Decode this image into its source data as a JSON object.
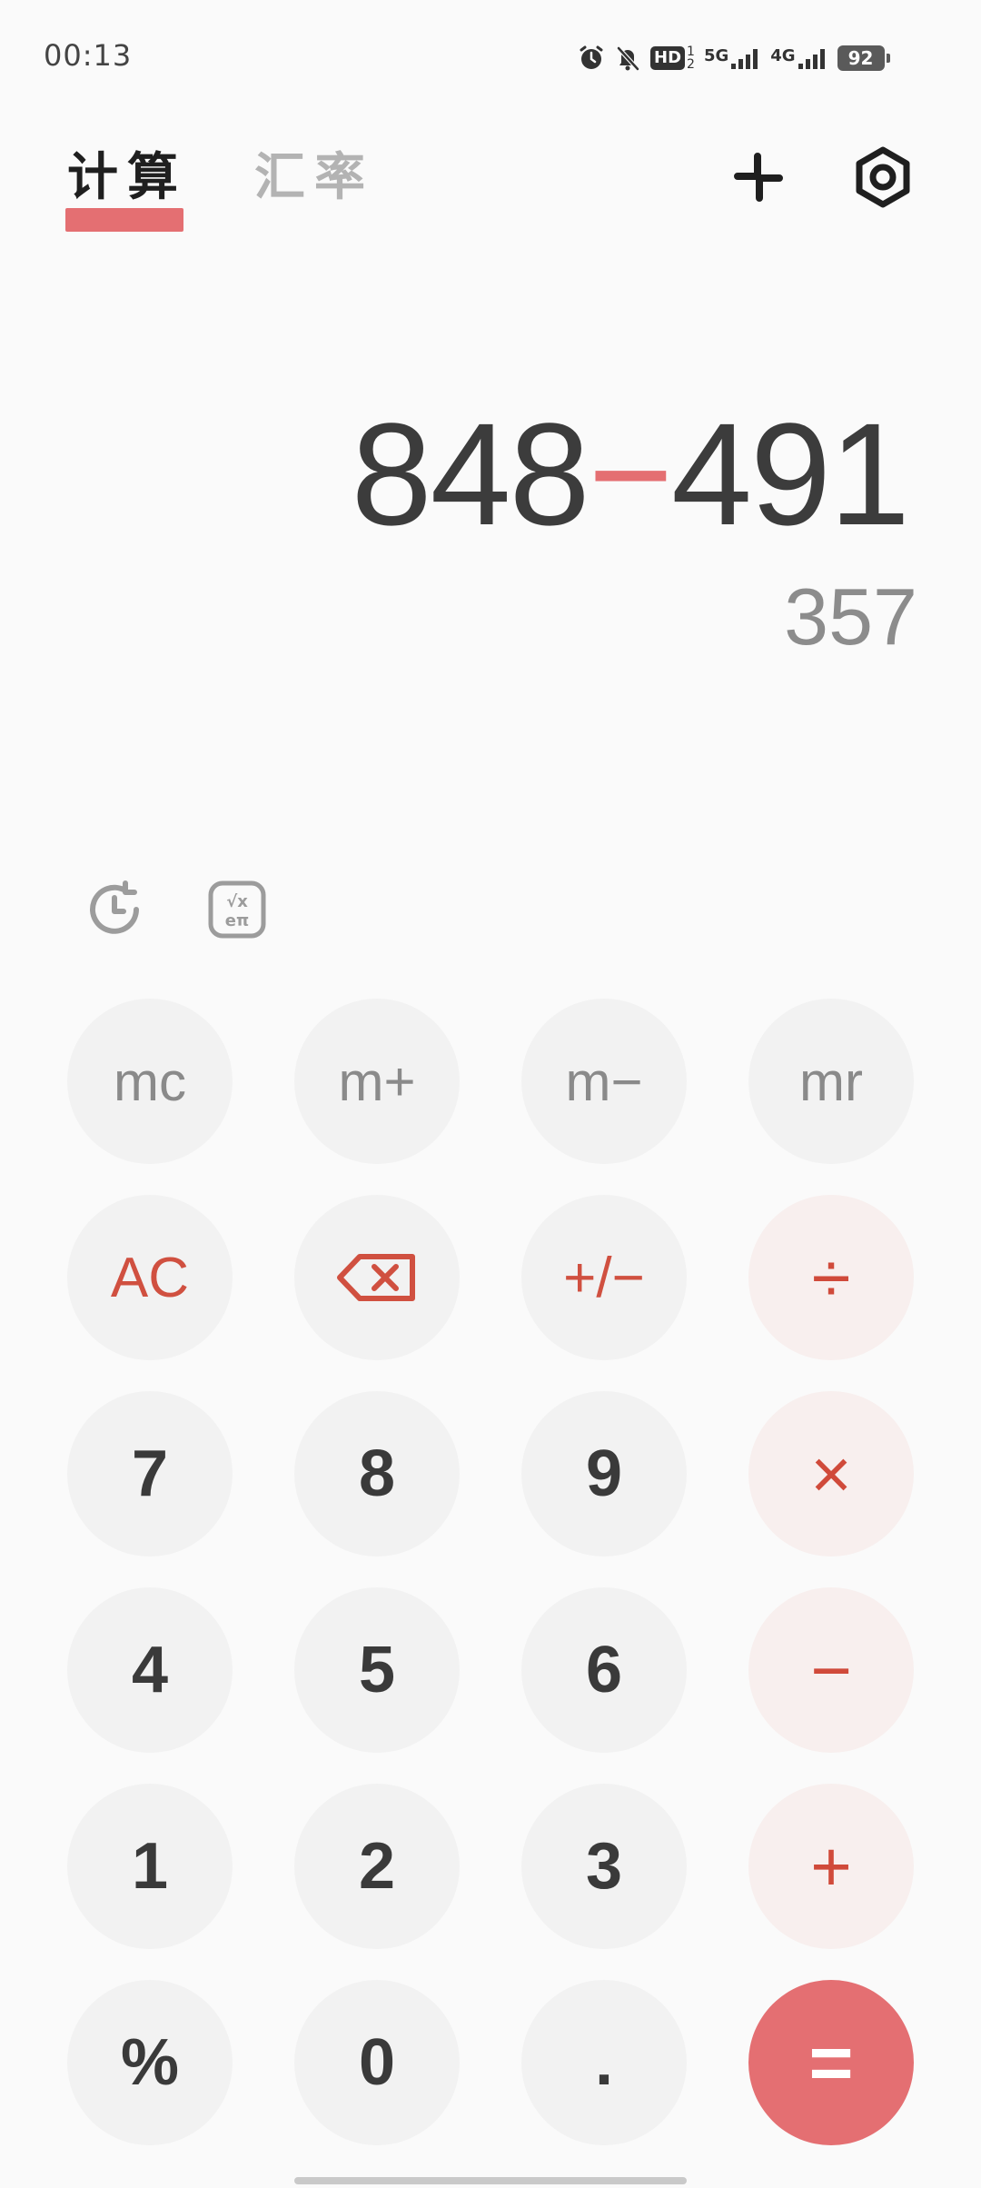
{
  "status_bar": {
    "time": "00:13",
    "hd_label": "HD",
    "hd_sub_top": "1",
    "hd_sub_bottom": "2",
    "net1_label": "5G",
    "net2_label": "4G",
    "battery": "92",
    "icons": [
      "alarm-icon",
      "mute-icon",
      "hd-icon",
      "signal-5g-icon",
      "signal-4g-icon",
      "battery-icon"
    ]
  },
  "header": {
    "tab_calculator": "计算",
    "tab_exchange": "汇率",
    "shrink_icon": "collapse-icon",
    "settings_icon": "settings-icon",
    "accent_color": "#e46f72"
  },
  "display": {
    "operand1": "848",
    "operator": "−",
    "operand2": "491",
    "result": "357"
  },
  "tools": {
    "history_icon": "history-icon",
    "scientific_icon": "scientific-icon"
  },
  "keypad": {
    "mc": "mc",
    "mplus": "m+",
    "mminus": "m−",
    "mr": "mr",
    "ac": "AC",
    "backspace_icon": "backspace-icon",
    "sign": "+/−",
    "divide": "÷",
    "seven": "7",
    "eight": "8",
    "nine": "9",
    "multiply": "×",
    "four": "4",
    "five": "5",
    "six": "6",
    "minus": "−",
    "one": "1",
    "two": "2",
    "three": "3",
    "plus": "+",
    "percent": "%",
    "zero": "0",
    "decimal": ".",
    "equals": "="
  }
}
